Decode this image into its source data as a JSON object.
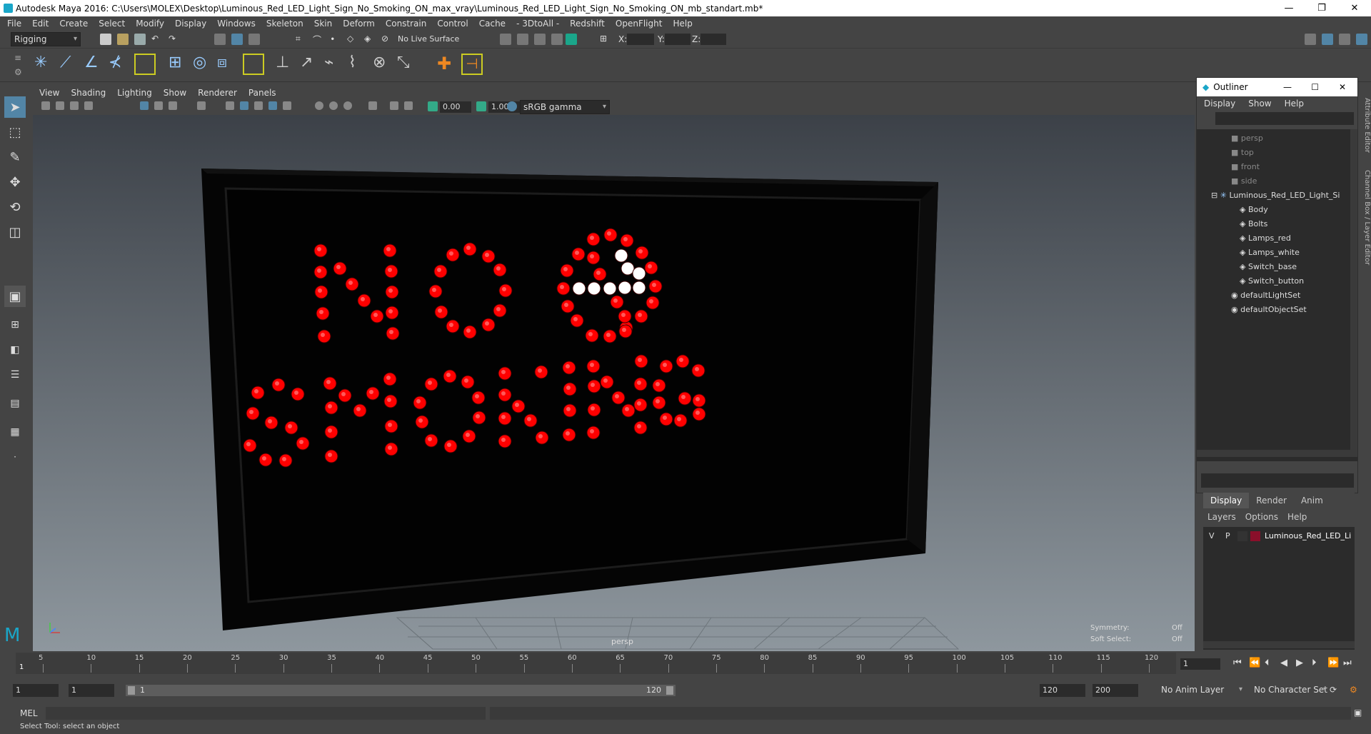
{
  "window": {
    "title": "Autodesk Maya 2016: C:\\Users\\MOLEX\\Desktop\\Luminous_Red_LED_Light_Sign_No_Smoking_ON_max_vray\\Luminous_Red_LED_Light_Sign_No_Smoking_ON_mb_standart.mb*"
  },
  "menubar": [
    "File",
    "Edit",
    "Create",
    "Select",
    "Modify",
    "Display",
    "Windows",
    "Skeleton",
    "Skin",
    "Deform",
    "Constrain",
    "Control",
    "Cache",
    "- 3DtoAll -",
    "Redshift",
    "OpenFlight",
    "Help"
  ],
  "status": {
    "mode": "Rigging",
    "live_surface": "No Live Surface",
    "x_label": "X:",
    "y_label": "Y:",
    "z_label": "Z:"
  },
  "panel_menu": [
    "View",
    "Shading",
    "Lighting",
    "Show",
    "Renderer",
    "Panels"
  ],
  "panel_toolbar": {
    "exposure": "0.00",
    "gamma": "1.00",
    "color_space": "sRGB gamma"
  },
  "viewport": {
    "camera": "persp",
    "symmetry_label": "Symmetry:",
    "symmetry_value": "Off",
    "soft_select_label": "Soft Select:",
    "soft_select_value": "Off"
  },
  "outliner": {
    "title": "Outliner",
    "menu": [
      "Display",
      "Show",
      "Help"
    ],
    "items": [
      {
        "label": "persp",
        "dim": true
      },
      {
        "label": "top",
        "dim": true
      },
      {
        "label": "front",
        "dim": true
      },
      {
        "label": "side",
        "dim": true
      },
      {
        "label": "Luminous_Red_LED_Light_Si",
        "dim": false
      },
      {
        "label": "Body",
        "dim": false
      },
      {
        "label": "Bolts",
        "dim": false
      },
      {
        "label": "Lamps_red",
        "dim": false
      },
      {
        "label": "Lamps_white",
        "dim": false
      },
      {
        "label": "Switch_base",
        "dim": false
      },
      {
        "label": "Switch_button",
        "dim": false
      },
      {
        "label": "defaultLightSet",
        "dim": false
      },
      {
        "label": "defaultObjectSet",
        "dim": false
      }
    ]
  },
  "layers": {
    "tabs": [
      "Display",
      "Render",
      "Anim"
    ],
    "menu": [
      "Layers",
      "Options",
      "Help"
    ],
    "row": {
      "v": "V",
      "p": "P",
      "name": "Luminous_Red_LED_Li"
    },
    "color": "#8a0f2a"
  },
  "side_tabs": [
    "Attribute Editor",
    "Channel Box / Layer Editor"
  ],
  "timeline": {
    "ticks": [
      "5",
      "10",
      "15",
      "20",
      "25",
      "30",
      "35",
      "40",
      "45",
      "50",
      "55",
      "60",
      "65",
      "70",
      "75",
      "80",
      "85",
      "90",
      "95",
      "100",
      "105",
      "110",
      "115",
      "120"
    ],
    "start_mark": "1",
    "current_frame": "1"
  },
  "range": {
    "start": "1",
    "inner_start": "1",
    "slider_start": "1",
    "slider_end": "120",
    "end": "120",
    "max": "200",
    "anim_layer": "No Anim Layer",
    "char_set": "No Character Set"
  },
  "cmd": {
    "label": "MEL"
  },
  "help_line": "Select Tool: select an object",
  "colors": {
    "led_red": "#ff0000",
    "led_white": "#ffffff",
    "accent": "#5285a6"
  }
}
